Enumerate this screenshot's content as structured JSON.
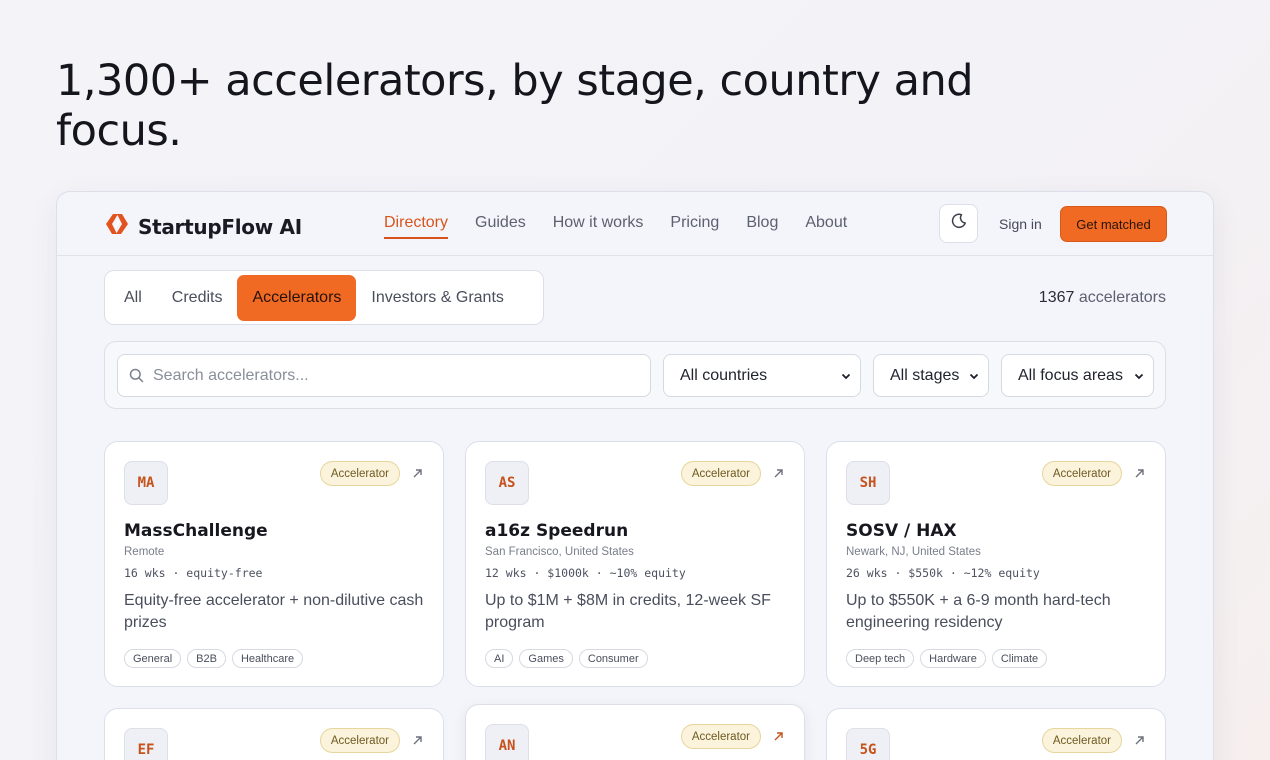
{
  "hero": {
    "title": "1,300+ accelerators, by stage, country and focus."
  },
  "nav": {
    "brand": "StartupFlow AI",
    "links": [
      "Directory",
      "Guides",
      "How it works",
      "Pricing",
      "Blog",
      "About"
    ],
    "active": "Directory",
    "signin": "Sign in",
    "cta": "Get matched"
  },
  "tabs": {
    "items": [
      "All",
      "Credits",
      "Accelerators",
      "Investors & Grants"
    ],
    "active": "Accelerators"
  },
  "count": {
    "number": "1367",
    "label": "accelerators"
  },
  "filters": {
    "search_placeholder": "Search accelerators...",
    "country": "All countries",
    "stage": "All stages",
    "focus": "All focus areas"
  },
  "colors": {
    "accent": "#f06a24",
    "active_link": "#d8541c",
    "badge_bg": "#fbf3dc"
  },
  "cards": [
    {
      "initials": "MA",
      "badge": "Accelerator",
      "name": "MassChallenge",
      "location": "Remote",
      "meta": "16 wks · equity-free",
      "desc": "Equity-free accelerator + non-dilutive cash prizes",
      "tags": [
        "General",
        "B2B",
        "Healthcare"
      ]
    },
    {
      "initials": "AS",
      "badge": "Accelerator",
      "name": "a16z Speedrun",
      "location": "San Francisco, United States",
      "meta": "12 wks · $1000k · ~10% equity",
      "desc": "Up to $1M + $8M in credits, 12-week SF program",
      "tags": [
        "AI",
        "Games",
        "Consumer"
      ]
    },
    {
      "initials": "SH",
      "badge": "Accelerator",
      "name": "SOSV / HAX",
      "location": "Newark, NJ, United States",
      "meta": "26 wks · $550k · ~12% equity",
      "desc": "Up to $550K + a 6-9 month hard-tech engineering residency",
      "tags": [
        "Deep tech",
        "Hardware",
        "Climate"
      ]
    },
    {
      "initials": "EF",
      "badge": "Accelerator"
    },
    {
      "initials": "AN",
      "badge": "Accelerator"
    },
    {
      "initials": "5G",
      "badge": "Accelerator"
    }
  ]
}
